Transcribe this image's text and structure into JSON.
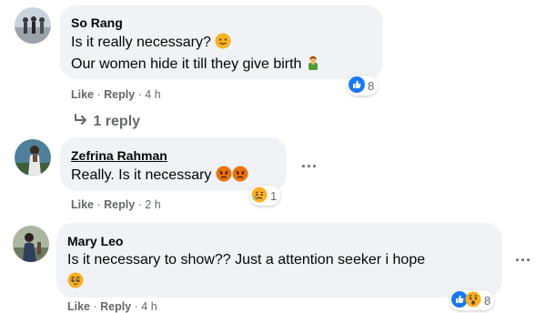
{
  "comments": [
    {
      "author": "So Rang",
      "lines": [
        "Is it really necessary?",
        "Our women hide it till they give birth"
      ],
      "actions": {
        "like": "Like",
        "reply": "Reply",
        "time": "4 h"
      },
      "reaction_count": "8",
      "reaction_icons": [
        "like-icon"
      ],
      "inline_emoji": [
        "slightly-smiling-face-icon",
        "man-facepalming-icon"
      ]
    },
    {
      "author": "Zefrina Rahman",
      "lines": [
        "Really. Is it necessary"
      ],
      "actions": {
        "like": "Like",
        "reply": "Reply",
        "time": "2 h"
      },
      "reaction_count": "1",
      "reaction_icons": [
        "sad-icon"
      ],
      "inline_emoji": [
        "angry-face-icon",
        "angry-face-icon"
      ]
    },
    {
      "author": "Mary Leo",
      "lines": [
        "Is it necessary to show?? Just a attention seeker i hope"
      ],
      "actions": {
        "like": "Like",
        "reply": "Reply",
        "time": "4 h"
      },
      "reaction_count": "8",
      "reaction_icons": [
        "like-icon",
        "wow-icon"
      ],
      "inline_emoji": [
        "pleading-face-icon"
      ]
    }
  ],
  "view_replies": "1 reply",
  "more_options": "...",
  "colors": {
    "bubble": "#f0f2f5",
    "secondary_text": "#65676b",
    "like_blue": "#1877f2",
    "reaction_yellow": "#f7b125",
    "angry_red": "#e9710f"
  }
}
